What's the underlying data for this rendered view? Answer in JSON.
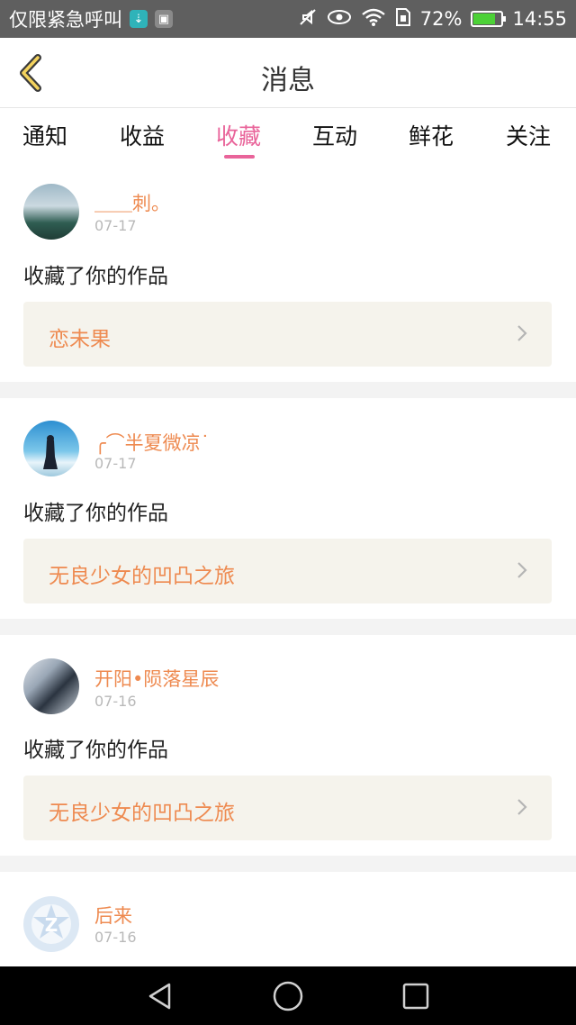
{
  "status_bar": {
    "carrier": "仅限紧急呼叫",
    "battery": "72%",
    "time": "14:55",
    "battery_level": 0.72
  },
  "header": {
    "title": "消息"
  },
  "tabs": [
    {
      "label": "通知",
      "active": false
    },
    {
      "label": "收益",
      "active": false
    },
    {
      "label": "收藏",
      "active": true
    },
    {
      "label": "互动",
      "active": false
    },
    {
      "label": "鲜花",
      "active": false
    },
    {
      "label": "关注",
      "active": false
    }
  ],
  "messages": [
    {
      "username": "＿＿刺。",
      "date": "07-17",
      "text": "收藏了你的作品",
      "work": "恋未果"
    },
    {
      "username": "╭⌒半夏微凉˙",
      "date": "07-17",
      "text": "收藏了你的作品",
      "work": "无良少女的凹凸之旅"
    },
    {
      "username": "开阳•陨落星辰",
      "date": "07-16",
      "text": "收藏了你的作品",
      "work": "无良少女的凹凸之旅"
    },
    {
      "username": "后来",
      "date": "07-16"
    }
  ],
  "colors": {
    "accent": "#e9649a",
    "username": "#ee8a50",
    "work_bg": "#f5f3ec"
  },
  "icons": [
    "download-icon",
    "gallery-icon",
    "mute-icon",
    "eye-icon",
    "wifi-icon",
    "sim-icon",
    "battery-icon",
    "back-chevron-icon",
    "chevron-right-icon",
    "nav-back-icon",
    "nav-home-icon",
    "nav-recents-icon"
  ]
}
